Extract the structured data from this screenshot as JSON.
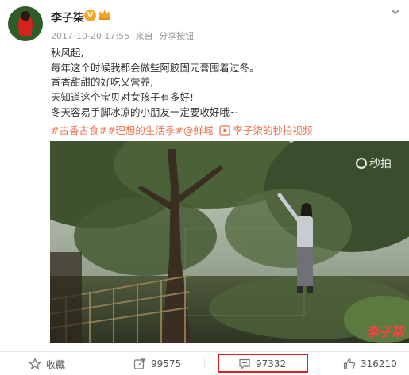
{
  "user": {
    "name": "李子柒",
    "verified_badge": "V"
  },
  "meta": {
    "date": "2017-10-20 17:55",
    "source": "来自",
    "action": "分享按钮"
  },
  "content": {
    "lines": [
      "秋风起,",
      "每年这个时候我都会做些阿胶固元膏囤着过冬。",
      "香香甜甜的好吃又营养,",
      "天知道这个宝贝对女孩子有多好!",
      "冬天容易手脚冰凉的小朋友一定要收好哦~"
    ],
    "tags": [
      "#古香古食#",
      "#理想的生活季#",
      "@鲜城"
    ],
    "video_link": "李子柒的秒拍视频"
  },
  "photo": {
    "watermark": "秒拍",
    "signature": "李子柒"
  },
  "actions": {
    "favorite_label": "收藏",
    "repost_count": "99575",
    "comment_count": "97332",
    "like_count": "316210"
  },
  "colors": {
    "accent_tag": "#eb7350",
    "highlight_border": "#e02020",
    "badge": "#f5a623"
  }
}
